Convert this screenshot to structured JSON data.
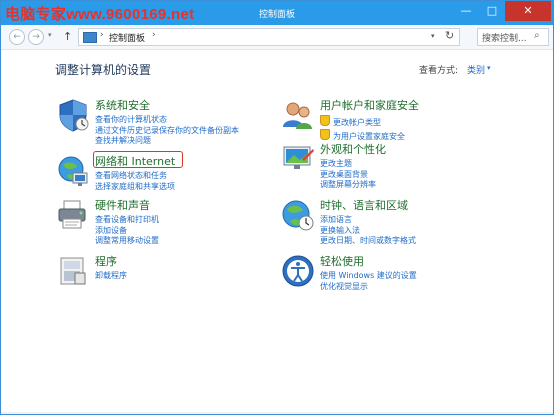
{
  "titlebar": {
    "watermark": "电脑专家www.9600169.net",
    "title": "控制面板",
    "minimize": "—",
    "maximize": "□",
    "close": "✕"
  },
  "nav": {
    "back": "←",
    "forward": "→",
    "dropdown": "▾",
    "up": "↑",
    "address_icon": "control-panel-icon",
    "address_sep": "›",
    "address_text": "控制面板",
    "address_dropdown": "▾",
    "refresh": "↻",
    "search_placeholder": "搜索控制...",
    "search_icon": "⌕"
  },
  "main": {
    "heading": "调整计算机的设置",
    "view_by_label": "查看方式:",
    "view_by_value": "类别",
    "view_by_caret": "▾"
  },
  "categories": [
    {
      "title": "系统和安全",
      "icon": "shield-icon",
      "links": [
        "查看你的计算机状态",
        "通过文件历史记录保存你的文件备份副本",
        "查找并解决问题"
      ]
    },
    {
      "title": "网络和 Internet",
      "icon": "network-icon",
      "links": [
        "查看网络状态和任务",
        "选择家庭组和共享选项"
      ]
    },
    {
      "title": "硬件和声音",
      "icon": "printer-icon",
      "links": [
        "查看设备和打印机",
        "添加设备",
        "调整常用移动设置"
      ]
    },
    {
      "title": "程序",
      "icon": "programs-icon",
      "links": [
        "卸载程序"
      ]
    },
    {
      "title": "用户帐户和家庭安全",
      "icon": "users-icon",
      "links": [
        "更改帐户类型",
        "为用户设置家庭安全"
      ]
    },
    {
      "title": "外观和个性化",
      "icon": "appearance-icon",
      "links": [
        "更改主题",
        "更改桌面背景",
        "调整屏幕分辨率"
      ]
    },
    {
      "title": "时钟、语言和区域",
      "icon": "globe-clock-icon",
      "links": [
        "添加语言",
        "更换输入法",
        "更改日期、时间或数字格式"
      ]
    },
    {
      "title": "轻松使用",
      "icon": "ease-of-access-icon",
      "links": [
        "使用 Windows 建议的设置",
        "优化视觉显示"
      ]
    }
  ],
  "colors": {
    "titlebar": "#2a9be8",
    "category_title": "#1f6e2c",
    "link": "#1f6cc7",
    "highlight_box": "#d13a2c"
  }
}
